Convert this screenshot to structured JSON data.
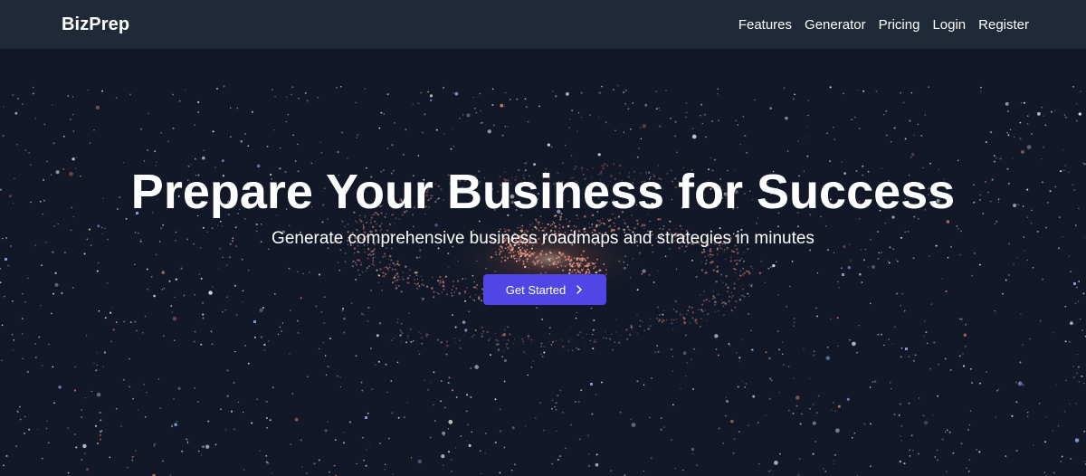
{
  "brand": {
    "name": "BizPrep"
  },
  "nav": {
    "items": [
      {
        "label": "Features"
      },
      {
        "label": "Generator"
      },
      {
        "label": "Pricing"
      },
      {
        "label": "Login"
      },
      {
        "label": "Register"
      }
    ]
  },
  "hero": {
    "title": "Prepare Your Business for Success",
    "subtitle": "Generate comprehensive business roadmaps and strategies in minutes",
    "cta": {
      "label": "Get Started",
      "icon": "chevron-right-icon"
    }
  },
  "colors": {
    "navbar_bg": "#202938",
    "hero_bg": "#121827",
    "accent": "#4f46e5",
    "text": "#ffffff",
    "particle_warm": "#e58a7a",
    "particle_cool": "#9fb4ff"
  }
}
